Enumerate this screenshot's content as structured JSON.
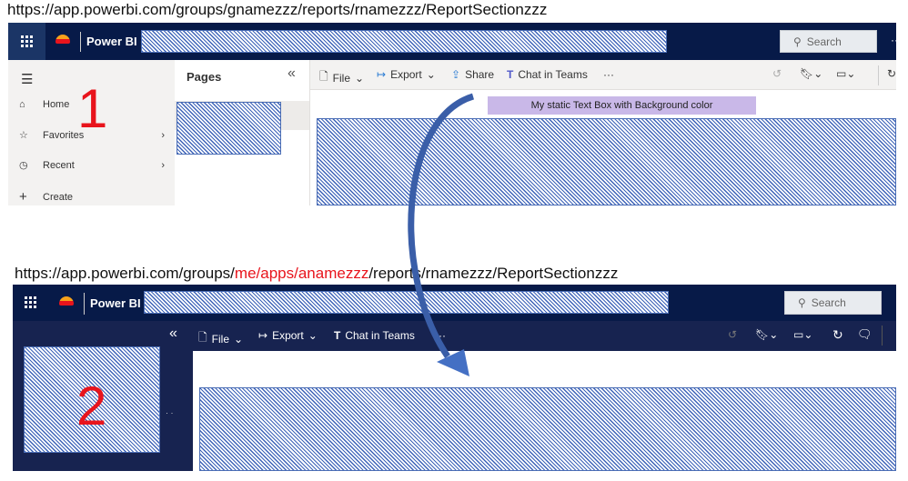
{
  "top": {
    "url": "https://app.powerbi.com/groups/gnamezzz/reports/rnamezzz/ReportSectionzzz",
    "app_name": "Power BI",
    "search_placeholder": "Search",
    "more": "···",
    "nav": {
      "items": [
        {
          "label": "Home",
          "icon": "home-icon"
        },
        {
          "label": "Favorites",
          "icon": "star-icon"
        },
        {
          "label": "Recent",
          "icon": "clock-icon"
        },
        {
          "label": "Create",
          "icon": "plus-icon"
        }
      ]
    },
    "marker": "1",
    "pages_title": "Pages",
    "toolbar": {
      "file": "File",
      "export": "Export",
      "share": "Share",
      "chat": "Chat in Teams",
      "more": "···"
    },
    "text_box": "My static Text Box with Background color",
    "text_box_color": "#c9b8e8"
  },
  "bottom": {
    "url_prefix": "https://app.powerbi.com/groups/",
    "url_highlight": "me/apps/anamezzz",
    "url_suffix": "/reports/rnamezzz/ReportSectionzzz",
    "app_name": "Power BI",
    "search_placeholder": "Search",
    "marker": "2",
    "toolbar": {
      "file": "File",
      "export": "Export",
      "chat": "Chat in Teams",
      "more": "···"
    }
  },
  "colors": {
    "header": "#071a48",
    "app_nav_dark": "#172350",
    "highlight_red": "#e8141c",
    "arrow": "#3a5ea8"
  }
}
